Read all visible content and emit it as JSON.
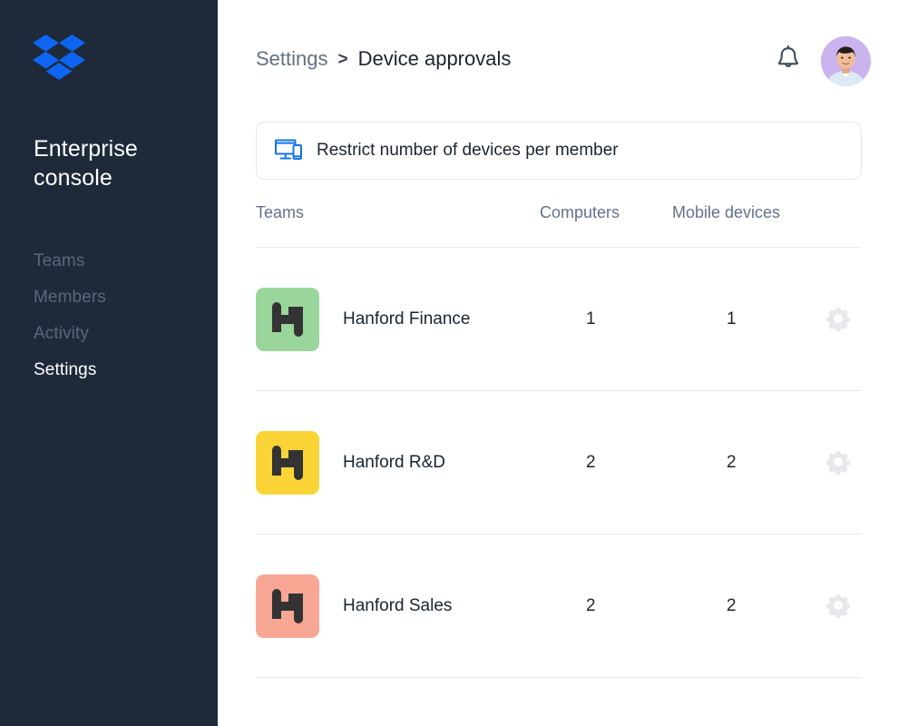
{
  "sidebar": {
    "logo_icon": "dropbox-logo-icon",
    "brand": "Enterprise console",
    "items": [
      {
        "label": "Teams",
        "icon": "teams-icon",
        "active": false
      },
      {
        "label": "Members",
        "icon": "members-icon",
        "active": false
      },
      {
        "label": "Activity",
        "icon": "activity-icon",
        "active": false
      },
      {
        "label": "Settings",
        "icon": "settings-icon",
        "active": true
      }
    ],
    "colors": {
      "background": "#1e2a3a",
      "item": "#5a6778",
      "item_active": "#ffffff",
      "logo": "#0d65f2"
    }
  },
  "header": {
    "breadcrumb": {
      "parent": "Settings",
      "separator": ">",
      "current": "Device approvals"
    },
    "notifications_icon": "bell-icon",
    "avatar_icon": "user-avatar",
    "avatar_bg": "#cbb3ef"
  },
  "restrict_card": {
    "icon": "devices-icon",
    "label": "Restrict number of devices per member",
    "icon_color": "#1274e8",
    "border_color": "#e4e7eb"
  },
  "table": {
    "headers": {
      "teams": "Teams",
      "computers": "Computers",
      "mobile": "Mobile devices"
    },
    "row_action_icon": "gear-icon",
    "rows": [
      {
        "logo_icon": "hanford-monogram-icon",
        "logo_bg": "#9ad59b",
        "name": "Hanford Finance",
        "computers": "1",
        "mobile": "1"
      },
      {
        "logo_icon": "hanford-monogram-icon",
        "logo_bg": "#fad436",
        "name": "Hanford R&D",
        "computers": "2",
        "mobile": "2"
      },
      {
        "logo_icon": "hanford-monogram-icon",
        "logo_bg": "#f9a795",
        "name": "Hanford Sales",
        "computers": "2",
        "mobile": "2"
      }
    ]
  }
}
